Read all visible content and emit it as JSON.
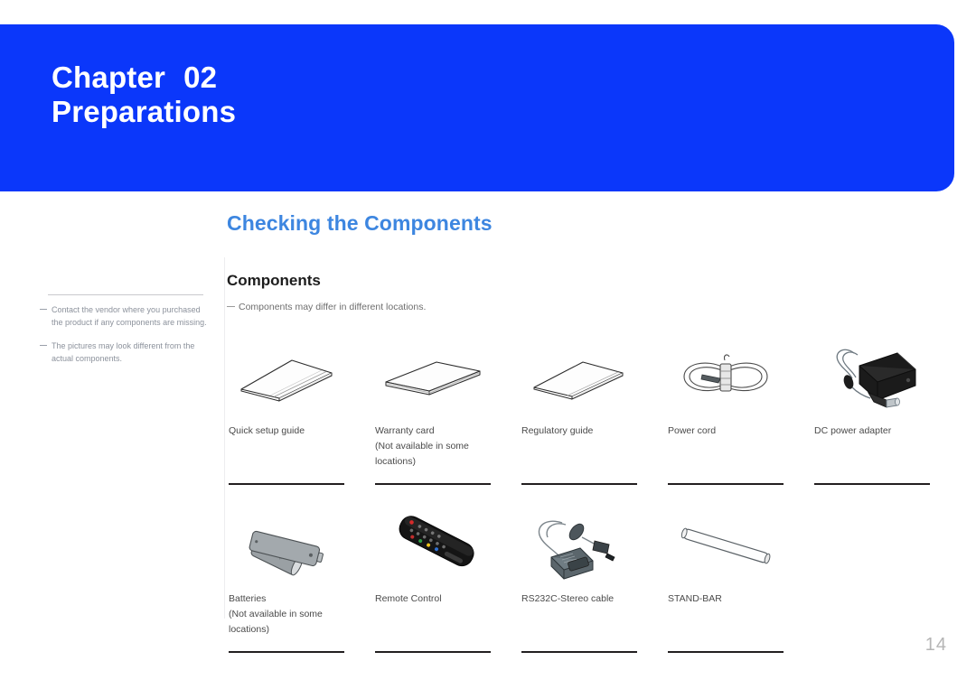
{
  "banner": {
    "chapter_word": "Chapter",
    "chapter_number": "02",
    "chapter_title": "Preparations",
    "accent_color": "#0b37fa"
  },
  "page_title": "Checking the Components",
  "section": {
    "heading": "Components",
    "note": "Components may differ in different locations."
  },
  "sidebar": {
    "notes": [
      "Contact the vendor where you purchased the product if any components are missing.",
      "The pictures may look different from the actual components."
    ]
  },
  "components": {
    "row1": [
      {
        "icon": "booklet-icon",
        "label_lines": [
          "Quick setup guide"
        ]
      },
      {
        "icon": "stacked-cards-icon",
        "label_lines": [
          "Warranty card",
          "(Not available in some",
          "locations)"
        ]
      },
      {
        "icon": "booklet-icon",
        "label_lines": [
          "Regulatory guide"
        ]
      },
      {
        "icon": "power-cord-icon",
        "label_lines": [
          "Power cord"
        ]
      },
      {
        "icon": "dc-power-adapter-icon",
        "label_lines": [
          "DC power adapter"
        ]
      }
    ],
    "row2": [
      {
        "icon": "batteries-icon",
        "label_lines": [
          "Batteries",
          "(Not available in some",
          "locations)"
        ]
      },
      {
        "icon": "remote-control-icon",
        "label_lines": [
          "Remote Control"
        ]
      },
      {
        "icon": "rs232c-cable-icon",
        "label_lines": [
          "RS232C-Stereo cable"
        ]
      },
      {
        "icon": "stand-bar-icon",
        "label_lines": [
          "STAND-BAR"
        ]
      }
    ]
  },
  "page_number": "14"
}
